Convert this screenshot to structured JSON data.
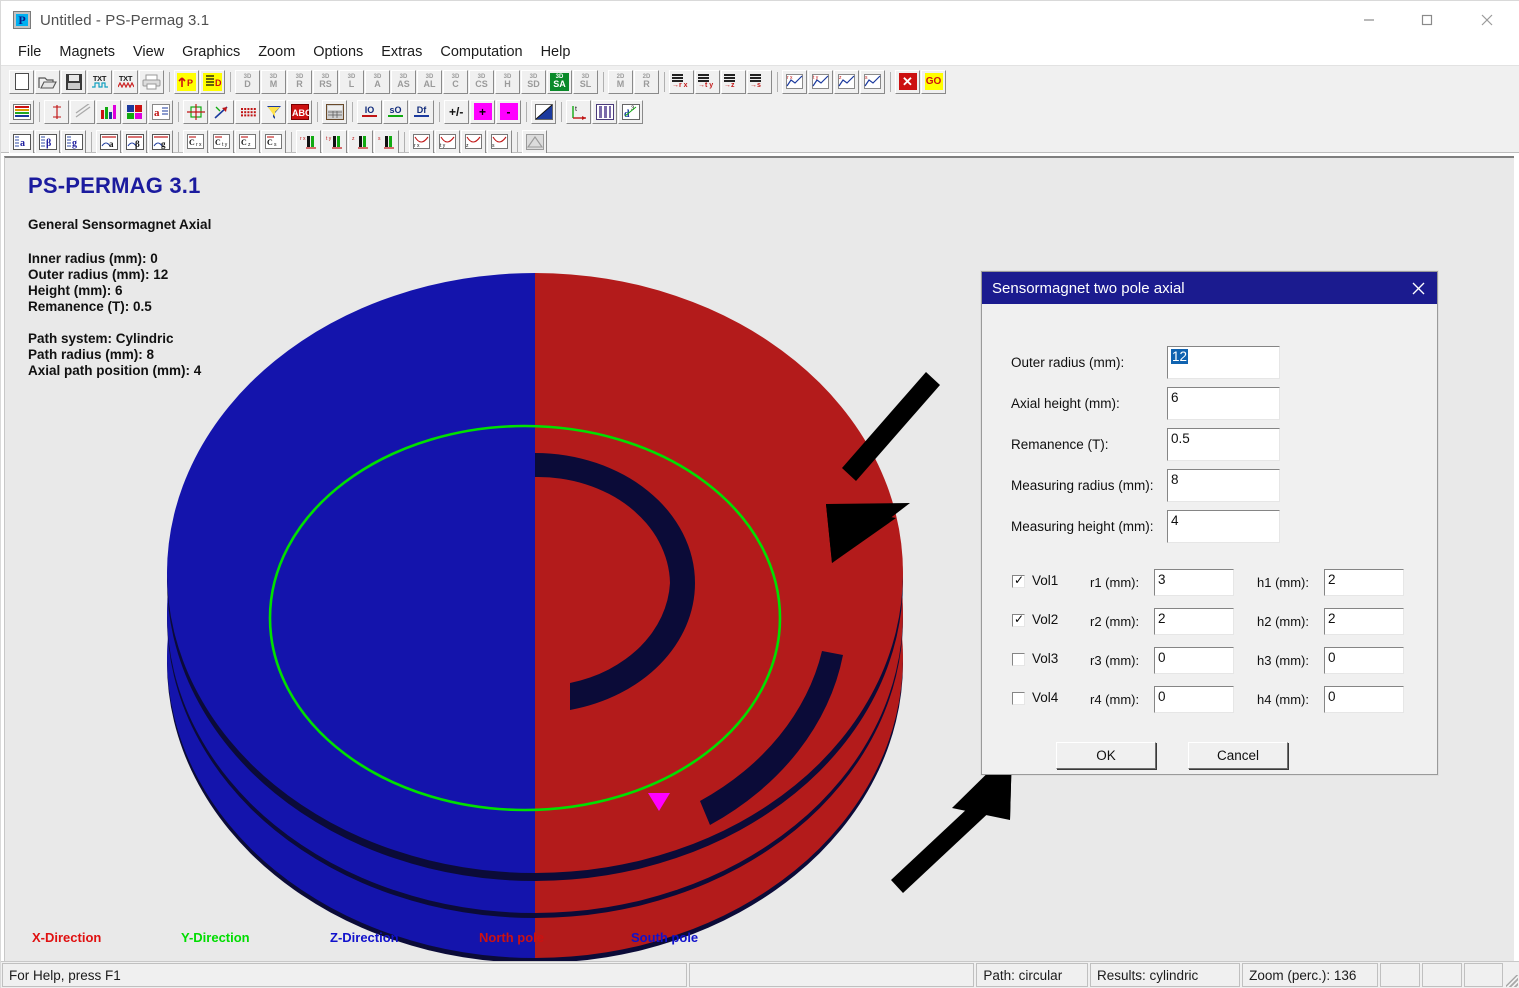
{
  "window": {
    "title": "Untitled - PS-Permag 3.1",
    "app_icon": "permag-app-icon",
    "minimize_label": "Minimize",
    "maximize_label": "Maximize",
    "close_label": "Close"
  },
  "menubar": {
    "items": [
      {
        "label": "File"
      },
      {
        "label": "Magnets"
      },
      {
        "label": "View"
      },
      {
        "label": "Graphics"
      },
      {
        "label": "Zoom"
      },
      {
        "label": "Options"
      },
      {
        "label": "Extras"
      },
      {
        "label": "Computation"
      },
      {
        "label": "Help"
      }
    ]
  },
  "toolbars": {
    "row1": [
      {
        "name": "new-file-icon",
        "kind": "doc",
        "text": ""
      },
      {
        "name": "open-file-icon",
        "kind": "folder",
        "text": ""
      },
      {
        "name": "save-file-icon",
        "kind": "disk",
        "text": ""
      },
      {
        "name": "import-txt-icon",
        "kind": "txt",
        "text": "TXT"
      },
      {
        "name": "export-txt-icon",
        "kind": "txt2",
        "text": "TXT"
      },
      {
        "name": "print-icon",
        "kind": "printer",
        "text": ""
      },
      {
        "sep": true
      },
      {
        "name": "parameter-up-icon",
        "kind": "yellow",
        "text": "P"
      },
      {
        "name": "data-list-icon",
        "kind": "yellow2",
        "text": "D"
      },
      {
        "sep": true
      },
      {
        "name": "magnet-3d-d-icon",
        "kind": "d3",
        "text": "D"
      },
      {
        "name": "magnet-3d-m-icon",
        "kind": "d3",
        "text": "M"
      },
      {
        "name": "magnet-3d-r-icon",
        "kind": "d3",
        "text": "R"
      },
      {
        "name": "magnet-3d-rs-icon",
        "kind": "d3",
        "text": "RS"
      },
      {
        "name": "magnet-3d-l-icon",
        "kind": "d3",
        "text": "L"
      },
      {
        "name": "magnet-3d-a-icon",
        "kind": "d3",
        "text": "A"
      },
      {
        "name": "magnet-3d-as-icon",
        "kind": "d3",
        "text": "AS"
      },
      {
        "name": "magnet-3d-al-icon",
        "kind": "d3",
        "text": "AL"
      },
      {
        "name": "magnet-3d-c-icon",
        "kind": "d3",
        "text": "C"
      },
      {
        "name": "magnet-3d-cs-icon",
        "kind": "d3",
        "text": "CS"
      },
      {
        "name": "magnet-3d-h-icon",
        "kind": "d3",
        "text": "H"
      },
      {
        "name": "magnet-3d-sd-icon",
        "kind": "d3",
        "text": "SD"
      },
      {
        "name": "magnet-3d-sa-icon",
        "kind": "d3active",
        "text": "SA"
      },
      {
        "name": "magnet-3d-sl-icon",
        "kind": "d3",
        "text": "SL"
      },
      {
        "sep": true
      },
      {
        "name": "magnet-2d-m-icon",
        "kind": "d2",
        "text": "M"
      },
      {
        "name": "magnet-2d-r-icon",
        "kind": "d2",
        "text": "R"
      },
      {
        "sep": true
      },
      {
        "name": "component-rx-icon",
        "kind": "lines",
        "text": "r x"
      },
      {
        "name": "component-ty-icon",
        "kind": "lines",
        "text": "t y"
      },
      {
        "name": "component-z-icon",
        "kind": "lines",
        "text": "z"
      },
      {
        "name": "component-sum-icon",
        "kind": "lines",
        "text": "s"
      },
      {
        "sep": true
      },
      {
        "name": "chart-rx-icon",
        "kind": "chart",
        "text": "r x"
      },
      {
        "name": "chart-ty-icon",
        "kind": "chart",
        "text": "t y"
      },
      {
        "name": "chart-z-icon",
        "kind": "chart",
        "text": "z"
      },
      {
        "name": "chart-sum-icon",
        "kind": "chart",
        "text": "s"
      },
      {
        "sep": true
      },
      {
        "name": "stop-computation-icon",
        "kind": "redx",
        "text": "X"
      },
      {
        "name": "go-computation-icon",
        "kind": "go",
        "text": "GO"
      }
    ],
    "row2": [
      {
        "name": "color-table-icon",
        "kind": "colortable",
        "text": ""
      },
      {
        "sep": true
      },
      {
        "name": "axis-scale-icon",
        "kind": "axis",
        "text": ""
      },
      {
        "name": "line-style-icon",
        "kind": "lineslash",
        "text": ""
      },
      {
        "name": "bar-colors-icon",
        "kind": "barcolors",
        "text": ""
      },
      {
        "name": "palette-icon",
        "kind": "palette",
        "text": ""
      },
      {
        "name": "font-icon",
        "kind": "fonta",
        "text": "a"
      },
      {
        "sep": true
      },
      {
        "name": "grid-icon",
        "kind": "grid",
        "text": ""
      },
      {
        "name": "vector-icon",
        "kind": "vector",
        "text": ""
      },
      {
        "name": "dots-icon",
        "kind": "dots",
        "text": ""
      },
      {
        "name": "funnel-icon",
        "kind": "funnel",
        "text": ""
      },
      {
        "name": "abc-icon",
        "kind": "abc",
        "text": "ABC"
      },
      {
        "sep": true
      },
      {
        "name": "table-icon",
        "kind": "table",
        "text": ""
      },
      {
        "sep": true
      },
      {
        "name": "io-icon",
        "kind": "txtbox",
        "text": "IO"
      },
      {
        "name": "s0-icon",
        "kind": "txtbox2",
        "text": "sO"
      },
      {
        "name": "df-icon",
        "kind": "txtbox3",
        "text": "Df"
      },
      {
        "sep": true
      },
      {
        "name": "plus-minus-icon",
        "kind": "plusminus",
        "text": "+/-"
      },
      {
        "name": "add-icon",
        "kind": "magenta",
        "text": "+"
      },
      {
        "name": "subtract-icon",
        "kind": "magenta",
        "text": "-"
      },
      {
        "sep": true
      },
      {
        "name": "diagonal-chart-icon",
        "kind": "diagchart",
        "text": ""
      },
      {
        "sep": true
      },
      {
        "name": "coordinate-icon",
        "kind": "coord",
        "text": ""
      },
      {
        "name": "columns-icon",
        "kind": "columns",
        "text": ""
      },
      {
        "name": "power-icon",
        "kind": "power",
        "text": "3"
      }
    ],
    "row3": [
      {
        "name": "alpha-a-icon",
        "kind": "greeka",
        "text": "a"
      },
      {
        "name": "alpha-beta-icon",
        "kind": "greeka",
        "text": "β"
      },
      {
        "name": "alpha-g-icon",
        "kind": "greeka",
        "text": "g"
      },
      {
        "sep": true
      },
      {
        "name": "curve-a-icon",
        "kind": "curvea",
        "text": "a"
      },
      {
        "name": "curve-beta-icon",
        "kind": "curvea",
        "text": "β"
      },
      {
        "name": "curve-g-icon",
        "kind": "curvea",
        "text": "g"
      },
      {
        "sep": true
      },
      {
        "name": "coeff-rx-icon",
        "kind": "coeff",
        "text": "C r x"
      },
      {
        "name": "coeff-ty-icon",
        "kind": "coeff",
        "text": "C t y"
      },
      {
        "name": "coeff-z-icon",
        "kind": "coeff",
        "text": "C z"
      },
      {
        "name": "coeff-s-icon",
        "kind": "coeff",
        "text": "C s"
      },
      {
        "sep": true
      },
      {
        "name": "bar-rx-icon",
        "kind": "barsm",
        "text": "r x"
      },
      {
        "name": "bar-ty-icon",
        "kind": "barsm",
        "text": "t y"
      },
      {
        "name": "bar-z-icon",
        "kind": "barsm",
        "text": "z"
      },
      {
        "name": "bar-s-icon",
        "kind": "barsm",
        "text": "s"
      },
      {
        "sep": true
      },
      {
        "name": "plot-rx-icon",
        "kind": "plotsm",
        "text": "r x"
      },
      {
        "name": "plot-ty-icon",
        "kind": "plotsm",
        "text": "t y"
      },
      {
        "name": "plot-z-icon",
        "kind": "plotsm",
        "text": "z"
      },
      {
        "name": "plot-s-icon",
        "kind": "plotsm",
        "text": "s"
      },
      {
        "sep": true
      },
      {
        "name": "export-image-icon",
        "kind": "expimg",
        "text": ""
      }
    ]
  },
  "info": {
    "heading": "PS-PERMAG 3.1",
    "subtitle": "General Sensormagnet Axial",
    "group1": [
      "Inner radius (mm): 0",
      "Outer radius (mm): 12",
      "Height (mm): 6",
      "Remanence (T): 0.5"
    ],
    "group2": [
      "Path system: Cylindric",
      "Path radius (mm): 8",
      "Axial path position (mm): 4"
    ]
  },
  "legend": {
    "items": [
      {
        "label": "X-Direction",
        "color": "#e01010"
      },
      {
        "label": "Y-Direction",
        "color": "#00dd00"
      },
      {
        "label": "Z-Direction",
        "color": "#1111cc"
      },
      {
        "label": "North pole",
        "color": "#cc1111"
      },
      {
        "label": "South pole",
        "color": "#1111cc"
      }
    ]
  },
  "graphic": {
    "north_pole_color": "#b31b1b",
    "south_pole_color": "#1414ac",
    "side_shadow_color": "#0b0b38",
    "path_color": "#00e000",
    "marker_color": "#ff00ff",
    "background": "#e9e9e9"
  },
  "dialog": {
    "title": "Sensormagnet two pole axial",
    "close_icon": "close-icon",
    "fields": [
      {
        "label": "Outer radius (mm):",
        "value": "12",
        "selected": true
      },
      {
        "label": "Axial height (mm):",
        "value": "6",
        "selected": false
      },
      {
        "label": "Remanence (T):",
        "value": "0.5",
        "selected": false
      },
      {
        "label": "Measuring radius (mm):",
        "value": "8",
        "selected": false
      },
      {
        "label": "Measuring height (mm):",
        "value": "4",
        "selected": false
      }
    ],
    "volumes": [
      {
        "checkbox_label": "Vol1",
        "checked": true,
        "r_label": "r1 (mm):",
        "r_value": "3",
        "h_label": "h1 (mm):",
        "h_value": "2"
      },
      {
        "checkbox_label": "Vol2",
        "checked": true,
        "r_label": "r2 (mm):",
        "r_value": "2",
        "h_label": "h2 (mm):",
        "h_value": "2"
      },
      {
        "checkbox_label": "Vol3",
        "checked": false,
        "r_label": "r3 (mm):",
        "r_value": "0",
        "h_label": "h3 (mm):",
        "h_value": "0"
      },
      {
        "checkbox_label": "Vol4",
        "checked": false,
        "r_label": "r4 (mm):",
        "r_value": "0",
        "h_label": "h4 (mm):",
        "h_value": "0"
      }
    ],
    "ok_label": "OK",
    "cancel_label": "Cancel",
    "title_bar_color": "#1b1b8f"
  },
  "annotations": [
    {
      "name": "arrow-to-magnet",
      "direction": "down-left"
    },
    {
      "name": "arrow-to-vol2-checkbox",
      "direction": "up-right"
    }
  ],
  "statusbar": {
    "help_text": "For Help, press F1",
    "blank1": "",
    "path": "Path: circular",
    "results": "Results: cylindric",
    "zoom": "Zoom (perc.): 136",
    "extra1": "",
    "extra2": "",
    "extra3": ""
  }
}
